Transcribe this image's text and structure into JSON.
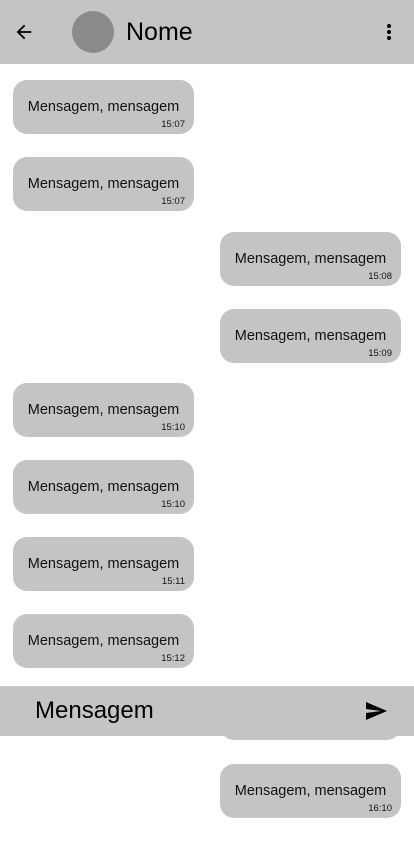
{
  "header": {
    "back_icon": "arrow-left-icon",
    "contact_name": "Nome",
    "menu_icon": "more-vertical-icon"
  },
  "messages": [
    {
      "text": "Mensagem, mensagem",
      "time": "15:07",
      "direction": "received"
    },
    {
      "text": "Mensagem, mensagem",
      "time": "15:07",
      "direction": "received"
    },
    {
      "text": "Mensagem, mensagem",
      "time": "15:08",
      "direction": "sent"
    },
    {
      "text": "Mensagem, mensagem",
      "time": "15:09",
      "direction": "sent"
    },
    {
      "text": "Mensagem, mensagem",
      "time": "15:10",
      "direction": "received"
    },
    {
      "text": "Mensagem, mensagem",
      "time": "15:10",
      "direction": "received"
    },
    {
      "text": "Mensagem, mensagem",
      "time": "15:11",
      "direction": "received"
    },
    {
      "text": "Mensagem, mensagem",
      "time": "15:12",
      "direction": "received"
    },
    {
      "text": "",
      "time": "",
      "direction": "sent"
    },
    {
      "text": "Mensagem, mensagem",
      "time": "16:10",
      "direction": "sent"
    }
  ],
  "composer": {
    "placeholder": "Mensagem",
    "send_icon": "send-icon"
  },
  "colors": {
    "bar": "#c4c4c4",
    "bubble": "#c4c4c4",
    "avatar": "#8a8a8a"
  }
}
